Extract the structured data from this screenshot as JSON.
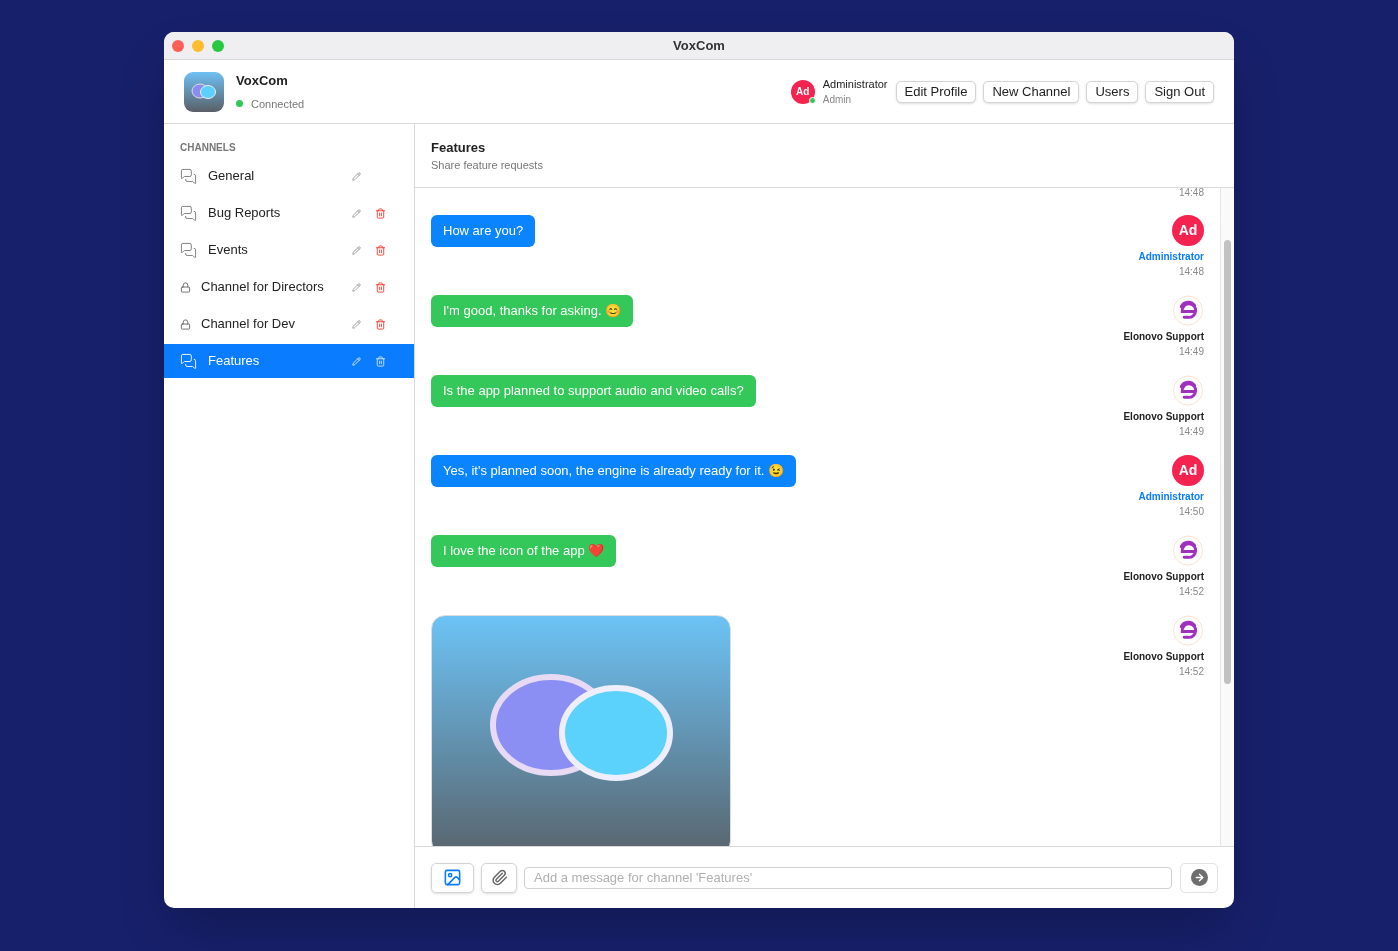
{
  "window": {
    "title": "VoxCom"
  },
  "app": {
    "name": "VoxCom",
    "status": "Connected",
    "online": true
  },
  "user": {
    "initials": "Ad",
    "name": "Administrator",
    "role": "Admin",
    "online": true
  },
  "header_buttons": [
    "Edit Profile",
    "New Channel",
    "Users",
    "Sign Out"
  ],
  "sidebar": {
    "heading": "CHANNELS",
    "channels": [
      {
        "name": "General",
        "kind": "public",
        "deletable": false,
        "selected": false
      },
      {
        "name": "Bug Reports",
        "kind": "public",
        "deletable": true,
        "selected": false
      },
      {
        "name": "Events",
        "kind": "public",
        "deletable": true,
        "selected": false
      },
      {
        "name": "Channel for Directors",
        "kind": "private",
        "deletable": true,
        "selected": false
      },
      {
        "name": "Channel for Dev",
        "kind": "private",
        "deletable": true,
        "selected": false
      },
      {
        "name": "Features",
        "kind": "public",
        "deletable": true,
        "selected": true
      }
    ]
  },
  "chat": {
    "title": "Features",
    "subtitle": "Share feature requests",
    "top_time": "14:48",
    "messages": [
      {
        "kind": "admin",
        "text": "How are you?",
        "initials": "Ad",
        "sender": "Administrator",
        "time": "14:48"
      },
      {
        "kind": "support",
        "text": "I'm good, thanks for asking. 😊",
        "sender": "Elonovo Support",
        "time": "14:49"
      },
      {
        "kind": "support",
        "text": "Is the app planned to support audio and video calls?",
        "sender": "Elonovo Support",
        "time": "14:49"
      },
      {
        "kind": "admin",
        "text": "Yes, it's planned soon, the engine is already ready for it.  😉",
        "initials": "Ad",
        "sender": "Administrator",
        "time": "14:50"
      },
      {
        "kind": "support",
        "text": "I love the icon of the app ❤️",
        "sender": "Elonovo Support",
        "time": "14:52"
      },
      {
        "kind": "image",
        "sender": "Elonovo Support",
        "time": "14:52"
      }
    ]
  },
  "composer": {
    "placeholder": "Add a message for channel 'Features'"
  }
}
